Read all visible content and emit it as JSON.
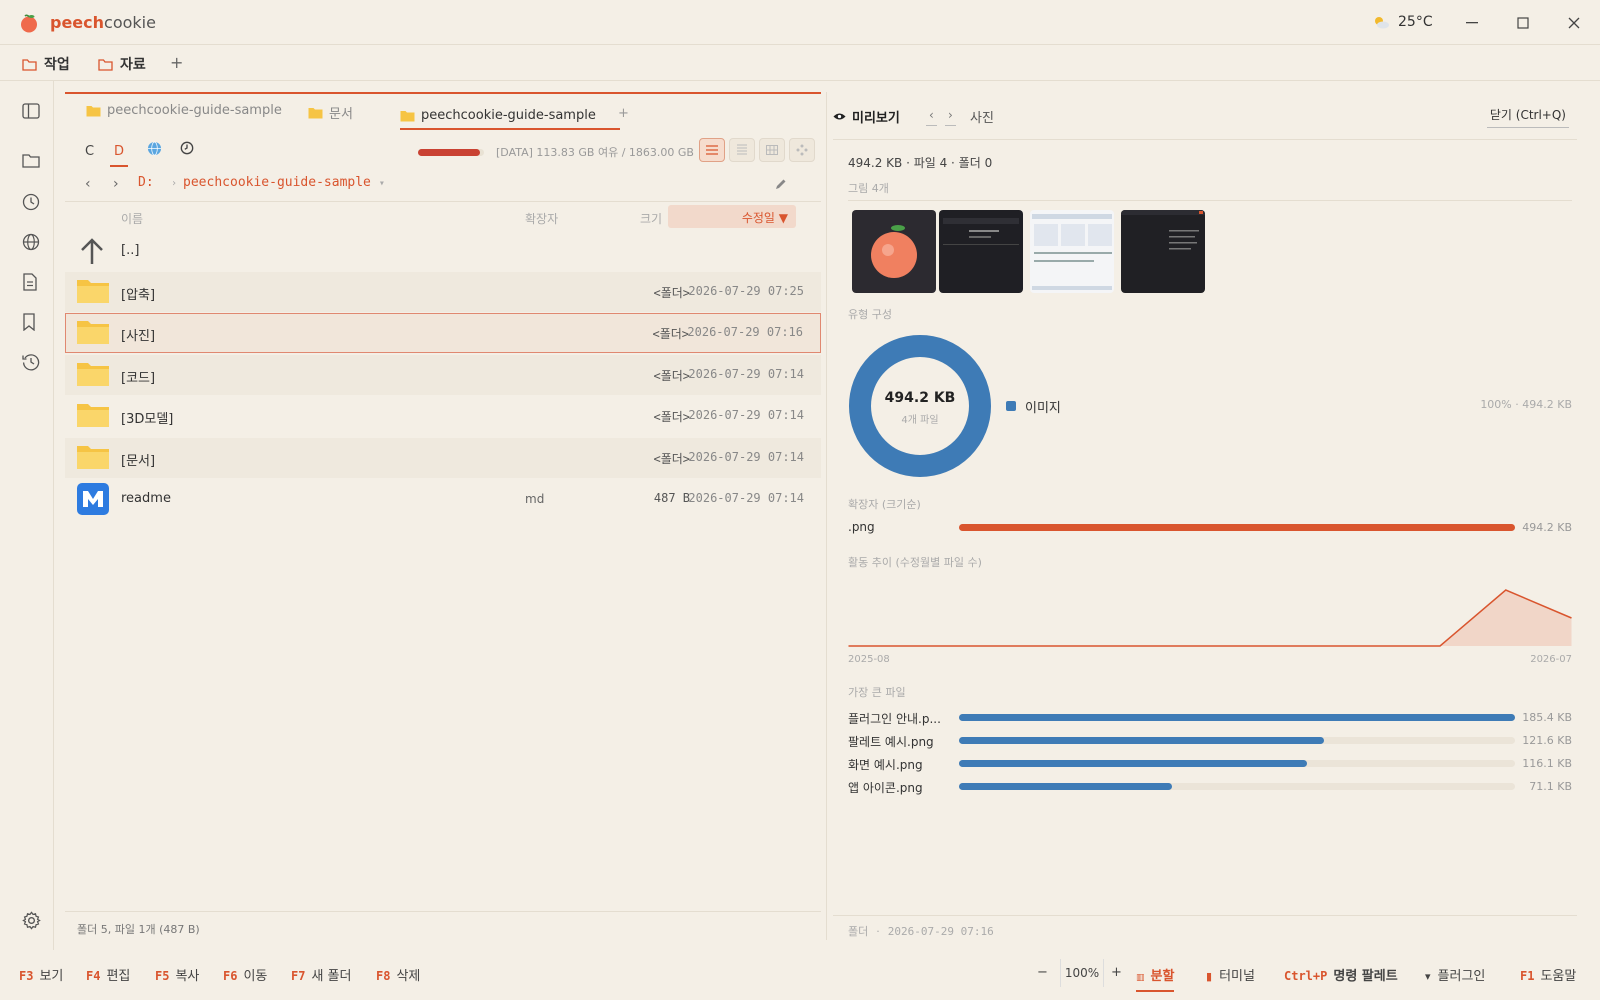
{
  "app": {
    "name_bold": "peech",
    "name_rest": "cookie",
    "weather": "25°C"
  },
  "workspace_tabs": [
    {
      "label": "작업"
    },
    {
      "label": "자료"
    }
  ],
  "file_tabs": [
    {
      "label": "peechcookie-guide-sample"
    },
    {
      "label": "문서"
    },
    {
      "label": "peechcookie-guide-sample",
      "active": true
    }
  ],
  "drives": {
    "c": "C",
    "d": "D"
  },
  "disk": {
    "text": "[DATA] 113.83 GB 여유 / 1863.00 GB",
    "used_fraction": 0.94
  },
  "path": {
    "drive": "D:",
    "folder": "peechcookie-guide-sample"
  },
  "columns": {
    "name": "이름",
    "ext": "확장자",
    "size": "크기",
    "date": "수정일 ▼"
  },
  "parent_row": "[..]",
  "rows": [
    {
      "name": "[압축]",
      "ext": "",
      "size": "<폴더>",
      "date": "2026-07-29 07:25"
    },
    {
      "name": "[사진]",
      "ext": "",
      "size": "<폴더>",
      "date": "2026-07-29 07:16"
    },
    {
      "name": "[코드]",
      "ext": "",
      "size": "<폴더>",
      "date": "2026-07-29 07:14"
    },
    {
      "name": "[3D모델]",
      "ext": "",
      "size": "<폴더>",
      "date": "2026-07-29 07:14"
    },
    {
      "name": "[문서]",
      "ext": "",
      "size": "<폴더>",
      "date": "2026-07-29 07:14"
    },
    {
      "name": "readme",
      "ext": "md",
      "size": "487 B",
      "date": "2026-07-29 07:14"
    }
  ],
  "file_status": "폴더 5, 파일 1개 (487 B)",
  "preview": {
    "title": "미리보기",
    "folder": "사진",
    "close": "닫기 (Ctrl+Q)",
    "summary": "494.2 KB · 파일 4 · 폴더 0",
    "images_label": "그림 4개",
    "type_label": "유형 구성",
    "donut_total": "494.2 KB",
    "donut_count": "4개 파일",
    "legend_label": "이미지",
    "legend_value": "100% · 494.2 KB",
    "ext_label": "확장자 (크기순)",
    "ext_name": ".png",
    "ext_value": "494.2 KB",
    "trend_label": "활동 추이 (수정월별 파일 수)",
    "trend_start": "2025-08",
    "trend_end": "2026-07",
    "largest_label": "가장 큰 파일",
    "largest": [
      {
        "name": "플러그인 안내.p...",
        "value": "185.4 KB",
        "kb": 185.4
      },
      {
        "name": "팔레트 예시.png",
        "value": "121.6 KB",
        "kb": 121.6
      },
      {
        "name": "화면 예시.png",
        "value": "116.1 KB",
        "kb": 116.1
      },
      {
        "name": "앱 아이콘.png",
        "value": "71.1 KB",
        "kb": 71.1
      }
    ],
    "status_kind": "폴더",
    "status_date": "2026-07-29 07:16"
  },
  "fn_keys": [
    {
      "key": "F3",
      "label": "보기"
    },
    {
      "key": "F4",
      "label": "편집"
    },
    {
      "key": "F5",
      "label": "복사"
    },
    {
      "key": "F6",
      "label": "이동"
    },
    {
      "key": "F7",
      "label": "새 폴더"
    },
    {
      "key": "F8",
      "label": "삭제"
    }
  ],
  "right_keys": {
    "zoom": "100%",
    "split": "분할",
    "terminal": "터미널",
    "palette_key": "Ctrl+P",
    "palette": "명령 팔레트",
    "plugin": "플러그인",
    "help_key": "F1",
    "help": "도움말"
  },
  "chart_data": [
    {
      "type": "pie",
      "title": "유형 구성",
      "categories": [
        "이미지"
      ],
      "values": [
        494.2
      ],
      "unit": "KB"
    },
    {
      "type": "bar",
      "title": "확장자 (크기순)",
      "categories": [
        ".png"
      ],
      "values": [
        494.2
      ],
      "unit": "KB"
    },
    {
      "type": "area",
      "title": "활동 추이 (수정월별 파일 수)",
      "x": [
        "2025-08",
        "2025-09",
        "2025-10",
        "2025-11",
        "2025-12",
        "2026-01",
        "2026-02",
        "2026-03",
        "2026-04",
        "2026-05",
        "2026-06",
        "2026-07"
      ],
      "values": [
        0,
        0,
        0,
        0,
        0,
        0,
        0,
        0,
        0,
        0,
        4,
        2
      ]
    },
    {
      "type": "bar",
      "title": "가장 큰 파일",
      "categories": [
        "플러그인 안내.p...",
        "팔레트 예시.png",
        "화면 예시.png",
        "앱 아이콘.png"
      ],
      "values": [
        185.4,
        121.6,
        116.1,
        71.1
      ],
      "unit": "KB"
    }
  ],
  "colors": {
    "accent": "#d9552e",
    "bar_blue": "#3e7bb6",
    "bar_orange": "#d9552e",
    "background": "#f4efe6"
  }
}
